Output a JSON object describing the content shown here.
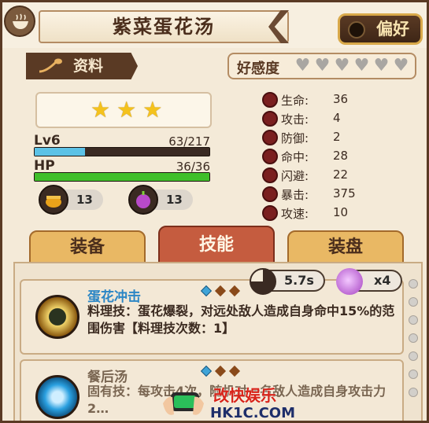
{
  "header": {
    "title": "紫菜蛋花汤",
    "preference_label": "偏好",
    "icon": "bowl-icon"
  },
  "info_tab": {
    "label": "资料",
    "icon": "spoon-icon"
  },
  "affinity": {
    "label": "好感度",
    "hearts_total": 6,
    "hearts_filled": 0
  },
  "stars": 3,
  "level": {
    "label": "Lv6",
    "exp": "63/217",
    "exp_fraction": 0.29
  },
  "hp": {
    "label": "HP",
    "value": "36/36",
    "fraction": 1.0
  },
  "resources": [
    {
      "icon": "pot-icon",
      "value": "13"
    },
    {
      "icon": "onion-icon",
      "value": "13"
    }
  ],
  "stats": [
    {
      "name": "生命:",
      "value": "36",
      "icon": "heart-icon"
    },
    {
      "name": "攻击:",
      "value": "4",
      "icon": "attack-icon"
    },
    {
      "name": "防御:",
      "value": "2",
      "icon": "defense-icon"
    },
    {
      "name": "命中:",
      "value": "28",
      "icon": "target-icon"
    },
    {
      "name": "闪避:",
      "value": "22",
      "icon": "dodge-icon"
    },
    {
      "name": "暴击:",
      "value": "375",
      "icon": "crit-icon"
    },
    {
      "name": "攻速:",
      "value": "10",
      "icon": "speed-icon"
    }
  ],
  "tabs": [
    {
      "label": "装备",
      "active": false
    },
    {
      "label": "技能",
      "active": true
    },
    {
      "label": "装盘",
      "active": false
    }
  ],
  "skills": [
    {
      "name": "蛋花冲击",
      "description": "料理技：蛋花爆裂，对远处敌人造成自身命中15%的范围伤害【料理技次数：1】",
      "cooldown": "5.7s",
      "cost": "x4",
      "gems": [
        "blue",
        "brown",
        "brown"
      ]
    },
    {
      "name": "餐后汤",
      "description": "固有技：每攻击4次，随机对一名敌人造成自身攻击力2…",
      "gems": [
        "blue",
        "brown",
        "brown"
      ]
    }
  ],
  "watermark": {
    "title": "改快娱乐",
    "url": "HK1C.COM"
  },
  "colors": {
    "exp_bar": "#5cc2e6",
    "hp_bar": "#3fbf2a",
    "active_tab": "#c55c3f",
    "skill_name": "#2b86c5"
  }
}
